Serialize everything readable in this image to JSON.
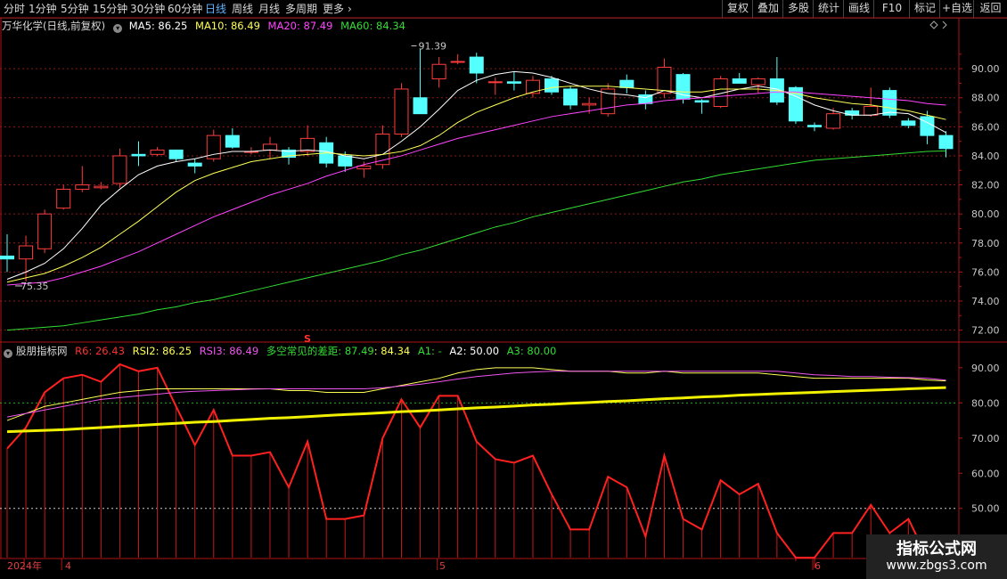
{
  "toolbar": {
    "periods": [
      "分时",
      "1分钟",
      "5分钟",
      "15分钟",
      "30分钟",
      "60分钟",
      "日线",
      "周线",
      "月线",
      "多周期",
      "更多"
    ],
    "active_period": "日线",
    "more_glyph": "›",
    "right_buttons": [
      "复权",
      "叠加",
      "多股",
      "统计",
      "画线",
      "F10",
      "标记",
      "+自选",
      "返回"
    ]
  },
  "price_panel": {
    "stock_name": "万华化学(日线,前复权)",
    "ma5_label": "MA5: 86.25",
    "ma10_label": "MA10: 86.49",
    "ma20_label": "MA20: 87.49",
    "ma60_label": "MA60: 84.34",
    "high_label": "91.39",
    "low_label": "75.35",
    "s_marker": "S"
  },
  "indicator_panel": {
    "name": "股朋指标网",
    "r6_label": "R6: 26.43",
    "rsi2_label": "RSI2: 86.25",
    "rsi3_label": "RSI3: 86.49",
    "gap_label": "多空常见的差距: 87.49",
    "gap_value": ": 84.34",
    "a1_label": "A1: -",
    "a2_label": "A2: 50.00",
    "a3_label": "A3: 80.00"
  },
  "colors": {
    "up": "#ff3c3c",
    "down": "#54ffff",
    "ma5": "#ffffff",
    "ma10": "#ffff55",
    "ma20": "#ff44ff",
    "ma60": "#33dd33",
    "grid": "#8b1a1a",
    "axis": "#b01515",
    "label": "#c8c8c8",
    "rsi2": "#ffff55",
    "rsi3": "#ee55ee",
    "thick": "#f0f000",
    "r6": "#ff2020",
    "a3": "#22aa22"
  },
  "chart_data": [
    {
      "type": "candlestick",
      "title": "万华化学(日线,前复权)",
      "y_ticks": [
        "72.00",
        "74.00",
        "76.00",
        "78.00",
        "80.00",
        "82.00",
        "84.00",
        "86.00",
        "88.00",
        "90.00"
      ],
      "ylim": [
        71.3,
        92.4
      ],
      "x_labels": [
        "2024年",
        "4",
        "5",
        "6"
      ],
      "candles": [
        {
          "o": 77.1,
          "h": 78.6,
          "l": 76.0,
          "c": 76.9
        },
        {
          "o": 76.9,
          "h": 78.5,
          "l": 75.35,
          "c": 77.8
        },
        {
          "o": 77.6,
          "h": 80.3,
          "l": 77.3,
          "c": 80.0
        },
        {
          "o": 80.4,
          "h": 82.0,
          "l": 80.3,
          "c": 81.7
        },
        {
          "o": 81.7,
          "h": 83.3,
          "l": 81.5,
          "c": 82.0
        },
        {
          "o": 81.8,
          "h": 82.2,
          "l": 81.7,
          "c": 81.9
        },
        {
          "o": 82.1,
          "h": 84.5,
          "l": 81.8,
          "c": 84.0
        },
        {
          "o": 84.1,
          "h": 85.0,
          "l": 83.3,
          "c": 84.0
        },
        {
          "o": 84.1,
          "h": 84.6,
          "l": 84.0,
          "c": 84.4
        },
        {
          "o": 84.4,
          "h": 84.4,
          "l": 83.6,
          "c": 83.8
        },
        {
          "o": 83.5,
          "h": 83.8,
          "l": 82.8,
          "c": 83.3
        },
        {
          "o": 83.8,
          "h": 85.8,
          "l": 83.6,
          "c": 85.4
        },
        {
          "o": 85.4,
          "h": 85.9,
          "l": 84.5,
          "c": 84.6
        },
        {
          "o": 84.3,
          "h": 84.6,
          "l": 84.1,
          "c": 84.3
        },
        {
          "o": 84.4,
          "h": 85.3,
          "l": 83.8,
          "c": 84.8
        },
        {
          "o": 84.4,
          "h": 84.6,
          "l": 83.4,
          "c": 83.9
        },
        {
          "o": 84.3,
          "h": 86.1,
          "l": 84.0,
          "c": 85.2
        },
        {
          "o": 84.9,
          "h": 85.3,
          "l": 83.2,
          "c": 83.5
        },
        {
          "o": 84.0,
          "h": 84.3,
          "l": 82.9,
          "c": 83.3
        },
        {
          "o": 83.1,
          "h": 83.6,
          "l": 82.5,
          "c": 83.3
        },
        {
          "o": 83.4,
          "h": 86.1,
          "l": 83.1,
          "c": 85.5
        },
        {
          "o": 85.5,
          "h": 89.0,
          "l": 85.3,
          "c": 88.6
        },
        {
          "o": 88.0,
          "h": 91.39,
          "l": 87.5,
          "c": 86.9
        },
        {
          "o": 89.3,
          "h": 90.8,
          "l": 88.7,
          "c": 90.3
        },
        {
          "o": 90.5,
          "h": 91.0,
          "l": 90.3,
          "c": 90.5
        },
        {
          "o": 90.8,
          "h": 91.1,
          "l": 89.0,
          "c": 89.7
        },
        {
          "o": 89.1,
          "h": 89.4,
          "l": 88.2,
          "c": 89.1
        },
        {
          "o": 89.1,
          "h": 89.8,
          "l": 88.5,
          "c": 89.0
        },
        {
          "o": 88.3,
          "h": 89.5,
          "l": 88.0,
          "c": 89.2
        },
        {
          "o": 89.3,
          "h": 89.5,
          "l": 88.2,
          "c": 88.4
        },
        {
          "o": 88.6,
          "h": 88.8,
          "l": 87.2,
          "c": 87.5
        },
        {
          "o": 87.5,
          "h": 88.0,
          "l": 86.9,
          "c": 87.6
        },
        {
          "o": 86.9,
          "h": 89.0,
          "l": 86.7,
          "c": 88.6
        },
        {
          "o": 89.2,
          "h": 89.6,
          "l": 88.3,
          "c": 88.7
        },
        {
          "o": 88.2,
          "h": 88.5,
          "l": 87.2,
          "c": 87.6
        },
        {
          "o": 88.3,
          "h": 90.7,
          "l": 88.0,
          "c": 90.1
        },
        {
          "o": 89.6,
          "h": 89.7,
          "l": 87.6,
          "c": 87.9
        },
        {
          "o": 87.8,
          "h": 87.9,
          "l": 86.9,
          "c": 87.7
        },
        {
          "o": 87.4,
          "h": 89.5,
          "l": 87.3,
          "c": 89.3
        },
        {
          "o": 89.3,
          "h": 89.7,
          "l": 89.0,
          "c": 89.0
        },
        {
          "o": 88.9,
          "h": 89.4,
          "l": 88.3,
          "c": 89.3
        },
        {
          "o": 89.3,
          "h": 90.8,
          "l": 87.5,
          "c": 87.7
        },
        {
          "o": 88.7,
          "h": 88.8,
          "l": 86.2,
          "c": 86.4
        },
        {
          "o": 86.1,
          "h": 86.3,
          "l": 85.7,
          "c": 86.0
        },
        {
          "o": 85.9,
          "h": 87.3,
          "l": 85.8,
          "c": 86.9
        },
        {
          "o": 87.1,
          "h": 87.3,
          "l": 86.5,
          "c": 86.8
        },
        {
          "o": 86.8,
          "h": 88.7,
          "l": 86.7,
          "c": 87.4
        },
        {
          "o": 88.5,
          "h": 88.7,
          "l": 86.6,
          "c": 86.8
        },
        {
          "o": 86.4,
          "h": 86.6,
          "l": 85.9,
          "c": 86.1
        },
        {
          "o": 86.7,
          "h": 87.1,
          "l": 84.8,
          "c": 85.4
        },
        {
          "o": 85.4,
          "h": 85.7,
          "l": 83.9,
          "c": 84.5
        }
      ],
      "series": [
        {
          "name": "MA5",
          "values": [
            75.5,
            76.0,
            76.6,
            77.6,
            79.0,
            80.6,
            81.7,
            82.7,
            83.3,
            83.6,
            83.8,
            84.1,
            84.3,
            84.3,
            84.4,
            84.3,
            84.4,
            84.3,
            84.0,
            83.8,
            84.1,
            85.0,
            86.0,
            87.2,
            88.5,
            89.2,
            89.6,
            89.8,
            89.7,
            89.4,
            89.0,
            88.6,
            88.3,
            88.2,
            88.0,
            88.5,
            88.2,
            88.0,
            88.3,
            88.6,
            88.8,
            88.6,
            88.1,
            87.5,
            87.1,
            86.8,
            86.8,
            87.0,
            86.9,
            86.3,
            85.6
          ]
        },
        {
          "name": "MA10",
          "values": [
            75.3,
            75.6,
            75.9,
            76.4,
            77.0,
            77.7,
            78.6,
            79.5,
            80.5,
            81.5,
            82.3,
            82.8,
            83.2,
            83.6,
            83.8,
            84.0,
            84.1,
            84.2,
            84.1,
            84.0,
            84.1,
            84.3,
            84.7,
            85.4,
            86.3,
            87.0,
            87.5,
            88.0,
            88.4,
            88.7,
            88.8,
            88.8,
            88.8,
            88.7,
            88.6,
            88.5,
            88.4,
            88.4,
            88.6,
            88.6,
            88.6,
            88.5,
            88.3,
            88.0,
            87.8,
            87.6,
            87.5,
            87.3,
            87.1,
            86.8,
            86.5
          ]
        },
        {
          "name": "MA20",
          "values": [
            75.1,
            75.2,
            75.3,
            75.6,
            76.0,
            76.4,
            76.9,
            77.4,
            78.0,
            78.6,
            79.2,
            79.8,
            80.3,
            80.8,
            81.3,
            81.7,
            82.1,
            82.6,
            83.0,
            83.4,
            83.7,
            84.0,
            84.4,
            84.8,
            85.2,
            85.5,
            85.8,
            86.1,
            86.4,
            86.7,
            86.9,
            87.1,
            87.3,
            87.5,
            87.6,
            87.8,
            87.9,
            88.0,
            88.1,
            88.2,
            88.3,
            88.4,
            88.4,
            88.3,
            88.2,
            88.1,
            88.0,
            87.9,
            87.8,
            87.6,
            87.49
          ]
        },
        {
          "name": "MA60",
          "values": [
            72.0,
            72.1,
            72.2,
            72.3,
            72.5,
            72.7,
            72.9,
            73.1,
            73.4,
            73.6,
            73.9,
            74.1,
            74.4,
            74.7,
            75.0,
            75.3,
            75.6,
            75.9,
            76.2,
            76.5,
            76.8,
            77.2,
            77.5,
            77.9,
            78.3,
            78.7,
            79.1,
            79.4,
            79.8,
            80.1,
            80.4,
            80.7,
            81.0,
            81.3,
            81.6,
            81.9,
            82.2,
            82.4,
            82.7,
            82.9,
            83.1,
            83.3,
            83.5,
            83.7,
            83.8,
            83.9,
            84.0,
            84.1,
            84.2,
            84.3,
            84.34
          ]
        }
      ]
    },
    {
      "type": "line",
      "title": "股朋指标网",
      "y_ticks": [
        "40.00",
        "50.00",
        "60.00",
        "70.00",
        "80.00",
        "90.00"
      ],
      "ylim": [
        36,
        93
      ],
      "reference_lines": [
        50,
        80
      ],
      "series": [
        {
          "name": "R6",
          "values": [
            67,
            73,
            83,
            87,
            88,
            86,
            91,
            89,
            90,
            79,
            68,
            78,
            65,
            65,
            66,
            56,
            69,
            47,
            47,
            48,
            70,
            81,
            73,
            82,
            82,
            69,
            64,
            63,
            65,
            54,
            44,
            44,
            59,
            56,
            42,
            65,
            47,
            44,
            58,
            54,
            57,
            43,
            35,
            33,
            43,
            43,
            51,
            43,
            47,
            35,
            26.43
          ]
        },
        {
          "name": "RSI2",
          "values": [
            75,
            77,
            79,
            80,
            81,
            82,
            83,
            83.5,
            84,
            84,
            84,
            84,
            84,
            84,
            84,
            83.5,
            83.5,
            83,
            83,
            83,
            84,
            85,
            86,
            87,
            88.5,
            89.5,
            90,
            90,
            90,
            89.5,
            89,
            89,
            89,
            88.5,
            88.5,
            89,
            88.5,
            88.5,
            88.5,
            88.5,
            88.5,
            88,
            87.5,
            87,
            87,
            87,
            87,
            87,
            87,
            86.5,
            86.25
          ]
        },
        {
          "name": "RSI3",
          "values": [
            76,
            77,
            78,
            79,
            80,
            81,
            81.5,
            82,
            82.5,
            83,
            83.3,
            83.5,
            83.7,
            83.9,
            84,
            84,
            84,
            84,
            84,
            84,
            84.3,
            84.8,
            85.3,
            86,
            86.8,
            87.5,
            88,
            88.5,
            88.8,
            89,
            89,
            89,
            89,
            89,
            89,
            89,
            89,
            89,
            89,
            89,
            89,
            89,
            88.5,
            88,
            87.8,
            87.5,
            87.5,
            87.3,
            87.2,
            87,
            86.49
          ]
        },
        {
          "name": "多空常见的差距",
          "values": [
            71.8,
            72.0,
            72.2,
            72.4,
            72.7,
            73.0,
            73.3,
            73.6,
            73.9,
            74.2,
            74.5,
            74.7,
            75.0,
            75.3,
            75.6,
            75.8,
            76.1,
            76.4,
            76.7,
            76.9,
            77.2,
            77.5,
            77.7,
            78.0,
            78.3,
            78.6,
            78.8,
            79.1,
            79.4,
            79.6,
            79.9,
            80.1,
            80.4,
            80.6,
            80.9,
            81.2,
            81.4,
            81.7,
            81.9,
            82.2,
            82.4,
            82.6,
            82.8,
            83.0,
            83.2,
            83.4,
            83.6,
            83.8,
            84.0,
            84.2,
            84.34
          ]
        }
      ]
    }
  ],
  "watermark": {
    "title": "指标公式网",
    "url": "www.zbgs3.com"
  }
}
